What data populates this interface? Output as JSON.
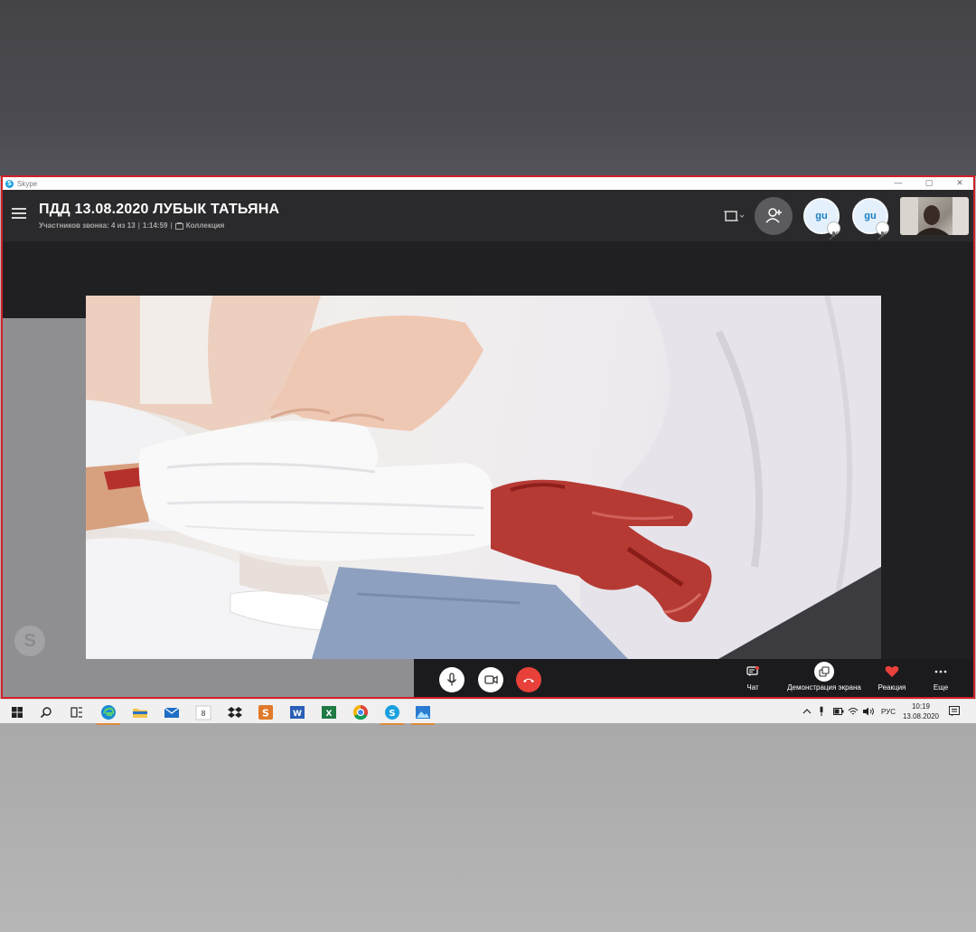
{
  "window": {
    "app_name": "Skype",
    "controls": {
      "minimize": "—",
      "maximize": "▢",
      "close": "✕"
    }
  },
  "call": {
    "title": "ПДД 13.08.2020 ЛУБЫК ТАТЬЯНА",
    "participants_label": "Участников звонка: 4 из 13",
    "duration": "1:14:59",
    "separator": "|",
    "collection_label": "Коллекция"
  },
  "participants": [
    {
      "initials": "gu",
      "muted": true
    },
    {
      "initials": "gu",
      "muted": true
    }
  ],
  "controls": {
    "chat": "Чат",
    "screen_share": "Демонстрация экрана",
    "reaction": "Реакция",
    "more": "Еще"
  },
  "taskbar": {
    "language": "РУС",
    "time": "10:19",
    "date": "13.08.2020"
  },
  "colors": {
    "frame_border": "#d3202a",
    "end_call": "#e8413a",
    "skype_blue": "#1aa0e0",
    "reaction_heart": "#e8413a"
  },
  "icons": {
    "menu": "hamburger-icon",
    "layout": "layout-icon",
    "add_person": "add-person-icon",
    "mic": "microphone-icon",
    "video": "video-camera-icon",
    "end": "end-call-icon",
    "chat": "chat-icon",
    "share": "screen-share-icon",
    "reaction": "heart-icon",
    "more": "more-icon"
  }
}
